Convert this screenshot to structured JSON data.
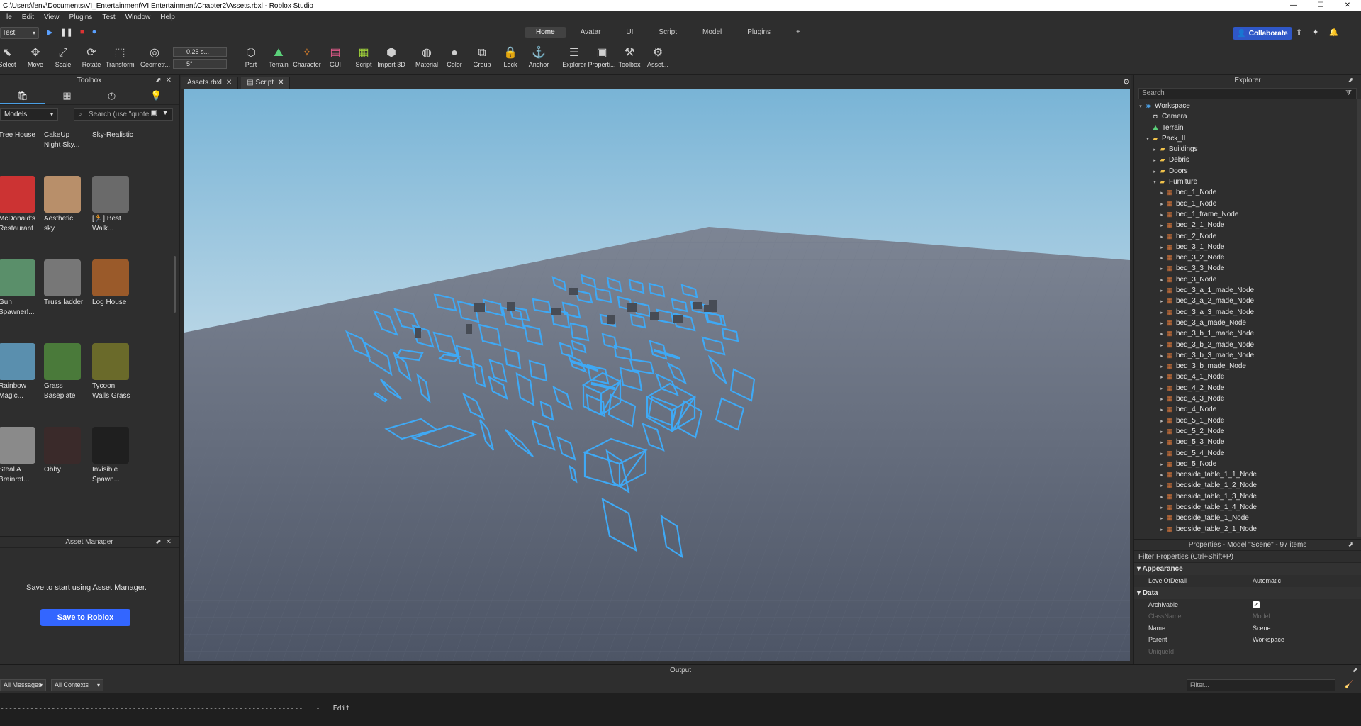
{
  "window": {
    "title": "C:\\Users\\fenv\\Documents\\VI_Entertainment\\VI Entertainment\\Chapter2\\Assets.rbxl - Roblox Studio",
    "minimize": "—",
    "maximize": "☐",
    "close": "✕"
  },
  "menu": [
    "le",
    "Edit",
    "View",
    "Plugins",
    "Test",
    "Window",
    "Help"
  ],
  "ribbon": {
    "mode": "Test",
    "tabs": [
      "Home",
      "Avatar",
      "UI",
      "Script",
      "Model",
      "Plugins",
      "+"
    ],
    "active_tab": "Home",
    "collaborate": "Collaborate"
  },
  "tools": [
    "Select",
    "Move",
    "Scale",
    "Rotate",
    "Transform",
    "Geometr...",
    "Part",
    "Terrain",
    "Character",
    "GUI",
    "Script",
    "Import 3D",
    "Material",
    "Color",
    "Group",
    "Lock",
    "Anchor",
    "Explorer",
    "Properti...",
    "Toolbox",
    "Asset..."
  ],
  "snap": {
    "move": "0.25 s...",
    "rotate": "5°"
  },
  "toolbox": {
    "title": "Toolbox",
    "category": "Models",
    "search_placeholder": "Search (use \"quote",
    "assets": [
      {
        "name": "Tree House",
        "thumb": "#6b4a2e"
      },
      {
        "name": "CakeUp\nNight Sky...",
        "thumb": "#3a2a8e"
      },
      {
        "name": "Sky-Realistic",
        "thumb": "#4a4a4a"
      },
      {
        "name": "McDonald's\nRestaurant",
        "thumb": "#c33"
      },
      {
        "name": "Aesthetic\nsky",
        "thumb": "#b88f6a"
      },
      {
        "name": "[🏃] Best\nWalk...",
        "thumb": "#6a6a6a"
      },
      {
        "name": "Gun\nSpawner!...",
        "thumb": "#5a8f6a"
      },
      {
        "name": "Truss ladder",
        "thumb": "#777"
      },
      {
        "name": "Log House",
        "thumb": "#9a5a2a"
      },
      {
        "name": "Rainbow\nMagic...",
        "thumb": "#5a8fae"
      },
      {
        "name": "Grass\nBaseplate",
        "thumb": "#4a7a3a"
      },
      {
        "name": "Tycoon\nWalls Grass",
        "thumb": "#6a6a2a"
      },
      {
        "name": "Steal A\nBrainrot...",
        "thumb": "#8a8a8a"
      },
      {
        "name": "Obby",
        "thumb": "#3a2a2a"
      },
      {
        "name": "Invisible\nSpawn...",
        "thumb": "#1f1f1f"
      }
    ]
  },
  "asset_manager": {
    "title": "Asset Manager",
    "message": "Save to start using Asset Manager.",
    "button": "Save to Roblox"
  },
  "doc_tabs": [
    {
      "label": "Assets.rbxl",
      "active": false
    },
    {
      "label": "Script",
      "active": true
    }
  ],
  "explorer": {
    "title": "Explorer",
    "search_placeholder": "Search",
    "items": [
      {
        "label": "Workspace",
        "depth": 0,
        "arrow": "▾",
        "icon": "workspace"
      },
      {
        "label": "Camera",
        "depth": 1,
        "arrow": "",
        "icon": "camera"
      },
      {
        "label": "Terrain",
        "depth": 1,
        "arrow": "",
        "icon": "terrain"
      },
      {
        "label": "Pack_II",
        "depth": 1,
        "arrow": "▾",
        "icon": "folder"
      },
      {
        "label": "Buildings",
        "depth": 2,
        "arrow": "▸",
        "icon": "folder"
      },
      {
        "label": "Debris",
        "depth": 2,
        "arrow": "▸",
        "icon": "folder"
      },
      {
        "label": "Doors",
        "depth": 2,
        "arrow": "▸",
        "icon": "folder"
      },
      {
        "label": "Furniture",
        "depth": 2,
        "arrow": "▾",
        "icon": "folder"
      },
      {
        "label": "bed_1_Node",
        "depth": 3,
        "arrow": "▸",
        "icon": "model"
      },
      {
        "label": "bed_1_Node",
        "depth": 3,
        "arrow": "▸",
        "icon": "model"
      },
      {
        "label": "bed_1_frame_Node",
        "depth": 3,
        "arrow": "▸",
        "icon": "model"
      },
      {
        "label": "bed_2_1_Node",
        "depth": 3,
        "arrow": "▸",
        "icon": "model"
      },
      {
        "label": "bed_2_Node",
        "depth": 3,
        "arrow": "▸",
        "icon": "model"
      },
      {
        "label": "bed_3_1_Node",
        "depth": 3,
        "arrow": "▸",
        "icon": "model"
      },
      {
        "label": "bed_3_2_Node",
        "depth": 3,
        "arrow": "▸",
        "icon": "model"
      },
      {
        "label": "bed_3_3_Node",
        "depth": 3,
        "arrow": "▸",
        "icon": "model"
      },
      {
        "label": "bed_3_Node",
        "depth": 3,
        "arrow": "▸",
        "icon": "model"
      },
      {
        "label": "bed_3_a_1_made_Node",
        "depth": 3,
        "arrow": "▸",
        "icon": "model"
      },
      {
        "label": "bed_3_a_2_made_Node",
        "depth": 3,
        "arrow": "▸",
        "icon": "model"
      },
      {
        "label": "bed_3_a_3_made_Node",
        "depth": 3,
        "arrow": "▸",
        "icon": "model"
      },
      {
        "label": "bed_3_a_made_Node",
        "depth": 3,
        "arrow": "▸",
        "icon": "model"
      },
      {
        "label": "bed_3_b_1_made_Node",
        "depth": 3,
        "arrow": "▸",
        "icon": "model"
      },
      {
        "label": "bed_3_b_2_made_Node",
        "depth": 3,
        "arrow": "▸",
        "icon": "model"
      },
      {
        "label": "bed_3_b_3_made_Node",
        "depth": 3,
        "arrow": "▸",
        "icon": "model"
      },
      {
        "label": "bed_3_b_made_Node",
        "depth": 3,
        "arrow": "▸",
        "icon": "model"
      },
      {
        "label": "bed_4_1_Node",
        "depth": 3,
        "arrow": "▸",
        "icon": "model"
      },
      {
        "label": "bed_4_2_Node",
        "depth": 3,
        "arrow": "▸",
        "icon": "model"
      },
      {
        "label": "bed_4_3_Node",
        "depth": 3,
        "arrow": "▸",
        "icon": "model"
      },
      {
        "label": "bed_4_Node",
        "depth": 3,
        "arrow": "▸",
        "icon": "model"
      },
      {
        "label": "bed_5_1_Node",
        "depth": 3,
        "arrow": "▸",
        "icon": "model"
      },
      {
        "label": "bed_5_2_Node",
        "depth": 3,
        "arrow": "▸",
        "icon": "model"
      },
      {
        "label": "bed_5_3_Node",
        "depth": 3,
        "arrow": "▸",
        "icon": "model"
      },
      {
        "label": "bed_5_4_Node",
        "depth": 3,
        "arrow": "▸",
        "icon": "model"
      },
      {
        "label": "bed_5_Node",
        "depth": 3,
        "arrow": "▸",
        "icon": "model"
      },
      {
        "label": "bedside_table_1_1_Node",
        "depth": 3,
        "arrow": "▸",
        "icon": "model"
      },
      {
        "label": "bedside_table_1_2_Node",
        "depth": 3,
        "arrow": "▸",
        "icon": "model"
      },
      {
        "label": "bedside_table_1_3_Node",
        "depth": 3,
        "arrow": "▸",
        "icon": "model"
      },
      {
        "label": "bedside_table_1_4_Node",
        "depth": 3,
        "arrow": "▸",
        "icon": "model"
      },
      {
        "label": "bedside_table_1_Node",
        "depth": 3,
        "arrow": "▸",
        "icon": "model"
      },
      {
        "label": "bedside_table_2_1_Node",
        "depth": 3,
        "arrow": "▸",
        "icon": "model"
      }
    ]
  },
  "properties": {
    "title": "Properties - Model \"Scene\" - 97 items",
    "filter_placeholder": "Filter Properties (Ctrl+Shift+P)",
    "sections": [
      {
        "name": "Appearance",
        "rows": [
          {
            "key": "LevelOfDetail",
            "value": "Automatic",
            "dim": false
          }
        ]
      },
      {
        "name": "Data",
        "rows": [
          {
            "key": "Archivable",
            "value": "✓",
            "dim": false,
            "checkbox": true
          },
          {
            "key": "ClassName",
            "value": "Model",
            "dim": true
          },
          {
            "key": "Name",
            "value": "Scene",
            "dim": false
          },
          {
            "key": "Parent",
            "value": "Workspace",
            "dim": false
          },
          {
            "key": "UniqueId",
            "value": "",
            "dim": true
          }
        ]
      }
    ]
  },
  "output": {
    "title": "Output",
    "messages_filter": "All Messages",
    "contexts_filter": "All Contexts",
    "filter_placeholder": "Filter...",
    "line": "-----------------------------------------------------------------------   -   Edit"
  },
  "colors": {
    "accent": "#2f57c7",
    "selection": "#3fa9f5",
    "sky_top": "#7fb8d8",
    "baseplate": "#5b6373"
  }
}
